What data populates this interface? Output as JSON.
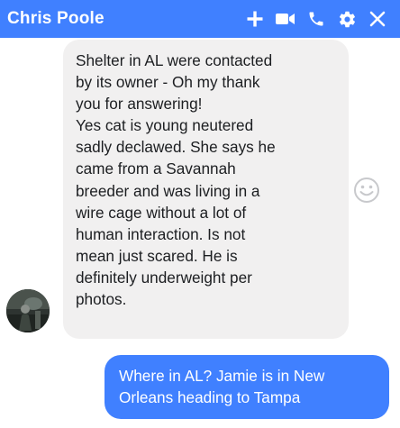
{
  "header": {
    "title": "Chris Poole",
    "icons": [
      "plus-icon",
      "video-camera-icon",
      "phone-icon",
      "gear-icon",
      "close-icon"
    ],
    "color": "#4080ff"
  },
  "messages": {
    "incoming": {
      "text": "Shelter in AL were contacted\nby its owner - Oh my thank\nyou for answering!\nYes cat is young neutered\nsadly declawed. She says he\ncame from a Savannah\nbreeder and was living in a\nwire cage without a lot of\nhuman interaction. Is not\nmean just scared. He is\ndefinitely underweight per\nphotos.",
      "bubble_color": "#f1f0f0"
    },
    "outgoing": {
      "text": "Where in AL?  Jamie is in New\nOrleans heading to Tampa",
      "bubble_color": "#4080ff"
    }
  },
  "reaction_icon": "smiley-icon"
}
